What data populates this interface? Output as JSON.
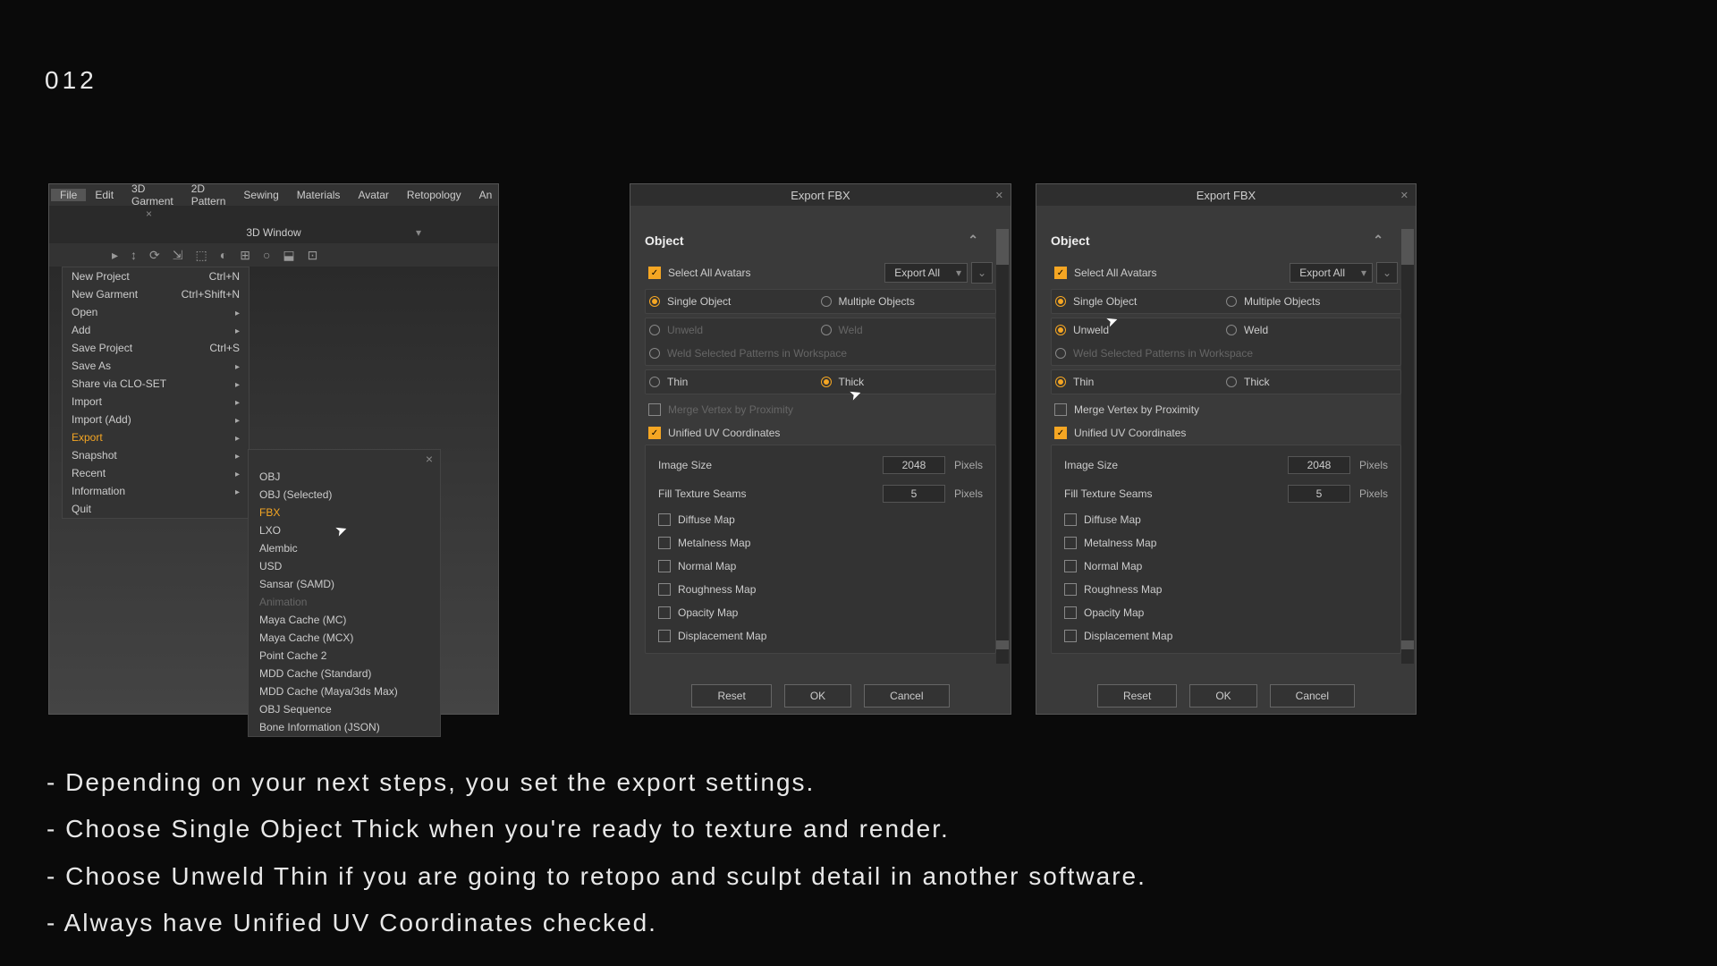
{
  "page_number": "012",
  "screenshot1": {
    "menubar": [
      "File",
      "Edit",
      "3D Garment",
      "2D Pattern",
      "Sewing",
      "Materials",
      "Avatar",
      "Retopology",
      "An"
    ],
    "active_menu": "File",
    "window_label": "3D Window",
    "menu_items": [
      {
        "label": "New Project",
        "shortcut": "Ctrl+N",
        "arrow": false
      },
      {
        "label": "New Garment",
        "shortcut": "Ctrl+Shift+N",
        "arrow": false
      },
      {
        "label": "Open",
        "shortcut": "",
        "arrow": true
      },
      {
        "label": "Add",
        "shortcut": "",
        "arrow": true
      },
      {
        "label": "Save Project",
        "shortcut": "Ctrl+S",
        "arrow": false
      },
      {
        "label": "Save As",
        "shortcut": "",
        "arrow": true
      },
      {
        "label": "Share via CLO-SET",
        "shortcut": "",
        "arrow": true
      },
      {
        "label": "Import",
        "shortcut": "",
        "arrow": true
      },
      {
        "label": "Import (Add)",
        "shortcut": "",
        "arrow": true
      },
      {
        "label": "Export",
        "shortcut": "",
        "arrow": true,
        "hl": true
      },
      {
        "label": "Snapshot",
        "shortcut": "",
        "arrow": true
      },
      {
        "label": "Recent",
        "shortcut": "",
        "arrow": true
      },
      {
        "label": "Information",
        "shortcut": "",
        "arrow": true
      },
      {
        "label": "Quit",
        "shortcut": "",
        "arrow": false
      }
    ],
    "submenu": [
      {
        "label": "OBJ"
      },
      {
        "label": "OBJ (Selected)"
      },
      {
        "label": "FBX",
        "hl": true
      },
      {
        "label": "LXO"
      },
      {
        "label": "Alembic"
      },
      {
        "label": "USD"
      },
      {
        "label": "Sansar (SAMD)"
      },
      {
        "label": "Animation",
        "disabled": true
      },
      {
        "label": "Maya Cache (MC)"
      },
      {
        "label": "Maya Cache (MCX)"
      },
      {
        "label": "Point Cache 2"
      },
      {
        "label": "MDD Cache (Standard)"
      },
      {
        "label": "MDD Cache (Maya/3ds Max)"
      },
      {
        "label": "OBJ Sequence"
      },
      {
        "label": "Bone Information (JSON)"
      }
    ]
  },
  "dialog": {
    "title": "Export FBX",
    "section": "Object",
    "select_all": "Select All Avatars",
    "export_dropdown": "Export All",
    "single_object": "Single Object",
    "multiple_objects": "Multiple Objects",
    "unweld": "Unweld",
    "weld": "Weld",
    "weld_selected": "Weld Selected Patterns in Workspace",
    "thin": "Thin",
    "thick": "Thick",
    "merge_vertex": "Merge Vertex by Proximity",
    "unified_uv": "Unified UV Coordinates",
    "image_size": "Image Size",
    "image_size_val": "2048",
    "fill_texture": "Fill Texture Seams",
    "fill_texture_val": "5",
    "pixels": "Pixels",
    "maps": [
      "Diffuse Map",
      "Metalness Map",
      "Normal Map",
      "Roughness Map",
      "Opacity Map",
      "Displacement Map"
    ],
    "reset": "Reset",
    "ok": "OK",
    "cancel": "Cancel"
  },
  "captions": [
    "- Depending on your next steps, you set the export settings.",
    "- Choose Single Object Thick when you're ready to texture and render.",
    "- Choose Unweld Thin if you are going to retopo and sculpt detail in another software.",
    "- Always have Unified UV Coordinates checked."
  ]
}
